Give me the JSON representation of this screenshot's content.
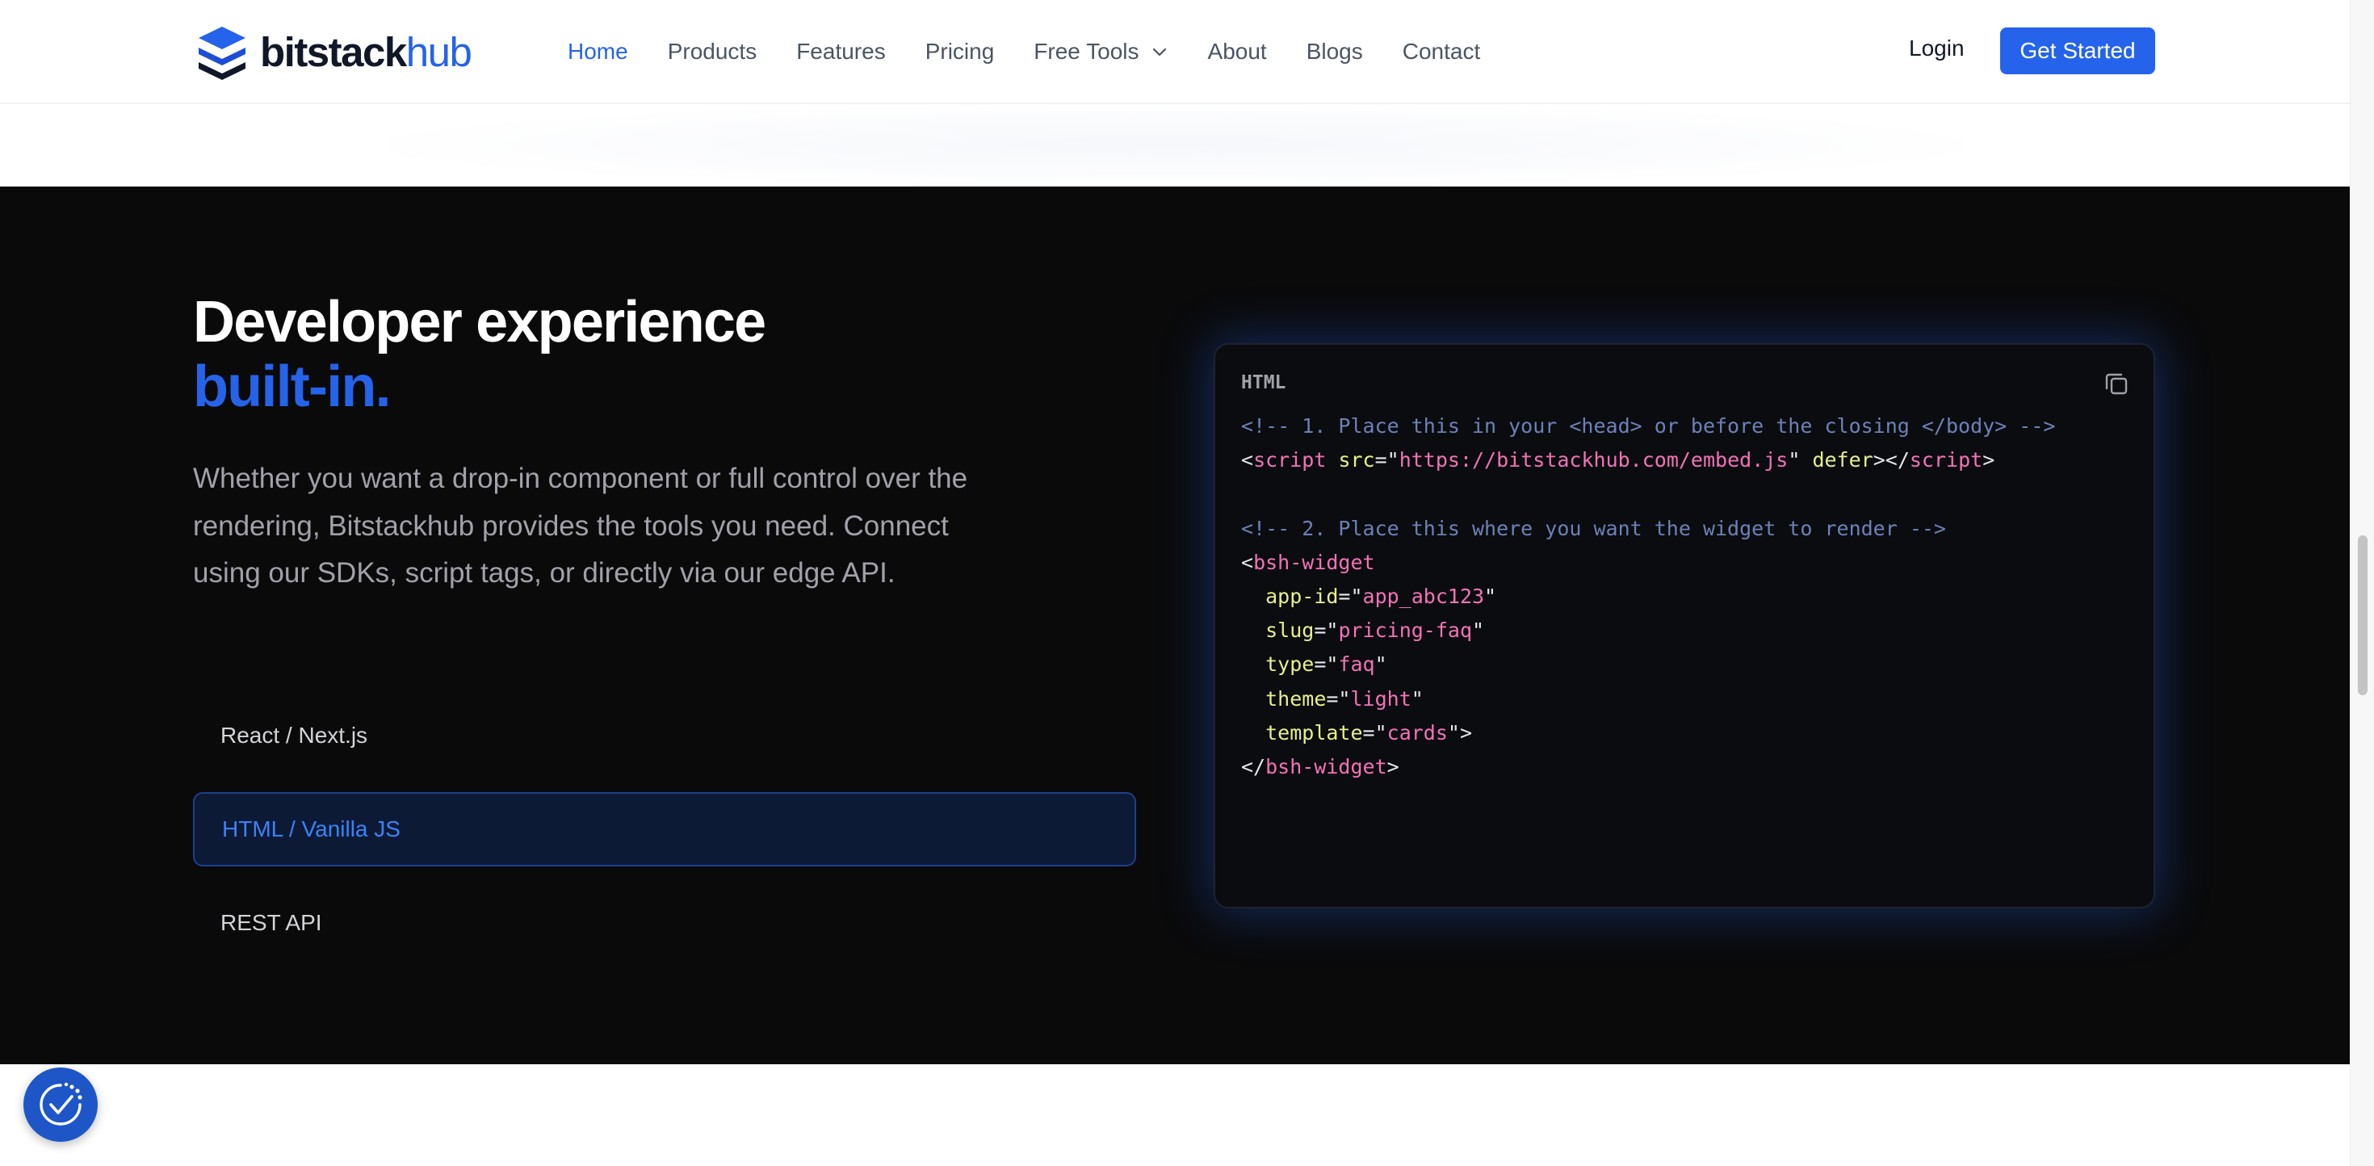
{
  "header": {
    "logo_part1": "bitstack",
    "logo_part2": "hub",
    "nav": [
      {
        "label": "Home"
      },
      {
        "label": "Products"
      },
      {
        "label": "Features"
      },
      {
        "label": "Pricing"
      },
      {
        "label": "Free Tools"
      },
      {
        "label": "About"
      },
      {
        "label": "Blogs"
      },
      {
        "label": "Contact"
      }
    ],
    "login_label": "Login",
    "cta_label": "Get Started"
  },
  "section": {
    "title": "Developer experience",
    "title_accent": "built-in.",
    "description": "Whether you want a drop-in component or full control over the rendering, Bitstackhub provides the tools you need. Connect using our SDKs, script tags, or directly via our edge API.",
    "tabs": [
      {
        "label": "React / Next.js"
      },
      {
        "label": "HTML / Vanilla JS"
      },
      {
        "label": "REST API"
      }
    ],
    "active_tab": "HTML / Vanilla JS"
  },
  "code_panel": {
    "language": "HTML",
    "comment1": "<!-- 1. Place this in your <head> or before the closing </body> -->",
    "script_tag": "script",
    "script_src_attr": "src",
    "script_src": "https://bitstackhub.com/embed.js",
    "script_defer": "defer",
    "comment2": "<!-- 2. Place this where you want the widget to render -->",
    "widget_tag": "bsh-widget",
    "attributes": [
      {
        "name": "app-id",
        "value": "app_abc123"
      },
      {
        "name": "slug",
        "value": "pricing-faq"
      },
      {
        "name": "type",
        "value": "faq"
      },
      {
        "name": "theme",
        "value": "light"
      },
      {
        "name": "template",
        "value": "cards"
      }
    ]
  },
  "icons": {
    "logo": "stacked-layers-icon",
    "nav_dropdown": "chevron-down-icon",
    "copy": "copy-icon",
    "badge": "check-shield-icon"
  },
  "colors": {
    "accent": "#2563eb",
    "dark_bg": "#0a0a0b",
    "code_tag": "#f472b6",
    "code_attr": "#e8f08a",
    "code_comment": "#6b82b8"
  }
}
